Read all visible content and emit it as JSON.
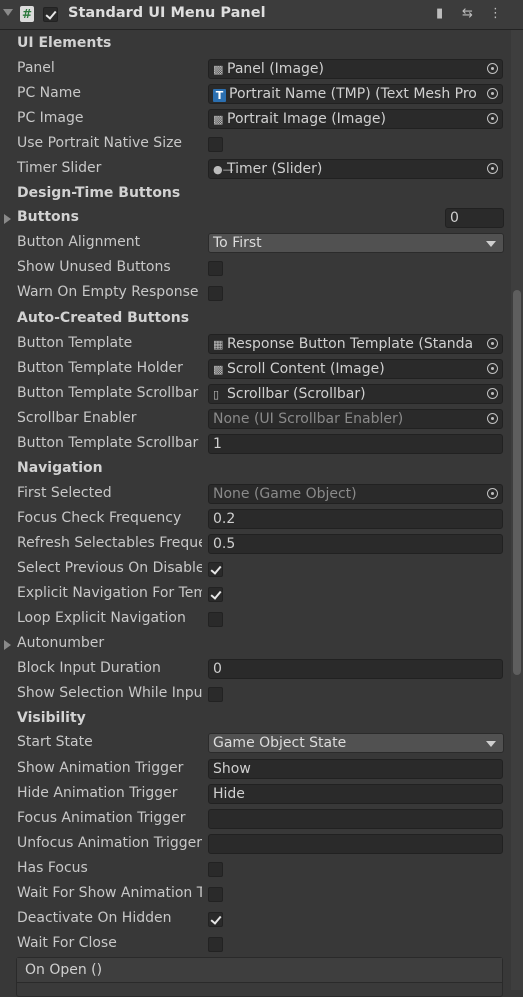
{
  "header": {
    "title": "Standard UI Menu Panel",
    "enabled": true,
    "icon_names": [
      "fold-arrow-icon",
      "script-icon",
      "preset-icon",
      "settings-sliders-icon",
      "kebab-menu-icon"
    ]
  },
  "sections": {
    "ui_elements": "UI Elements",
    "design_time_buttons": "Design-Time Buttons",
    "auto_created_buttons": "Auto-Created Buttons",
    "navigation": "Navigation",
    "visibility": "Visibility"
  },
  "fields": {
    "panel": {
      "label": "Panel",
      "value": "Panel (Image)"
    },
    "pc_name": {
      "label": "PC Name",
      "value": "Portrait Name (TMP) (Text Mesh Pro"
    },
    "pc_image": {
      "label": "PC Image",
      "value": "Portrait Image (Image)"
    },
    "use_portrait_native_size": {
      "label": "Use Portrait Native Size",
      "checked": false
    },
    "timer_slider": {
      "label": "Timer Slider",
      "value": "Timer (Slider)"
    },
    "buttons": {
      "label": "Buttons",
      "value": "0"
    },
    "button_alignment": {
      "label": "Button Alignment",
      "value": "To First"
    },
    "show_unused_buttons": {
      "label": "Show Unused Buttons",
      "checked": false
    },
    "warn_on_empty_response": {
      "label": "Warn On Empty Response",
      "checked": false
    },
    "button_template": {
      "label": "Button Template",
      "value": "Response Button Template (Standa"
    },
    "button_template_holder": {
      "label": "Button Template Holder",
      "value": "Scroll Content (Image)"
    },
    "button_template_scrollbar": {
      "label": "Button Template Scrollbar",
      "value": "Scrollbar (Scrollbar)"
    },
    "scrollbar_enabler": {
      "label": "Scrollbar Enabler",
      "value": "None (UI Scrollbar Enabler)"
    },
    "button_template_scrollbar_value": {
      "label": "Button Template Scrollbar",
      "value": "1"
    },
    "first_selected": {
      "label": "First Selected",
      "value": "None (Game Object)"
    },
    "focus_check_frequency": {
      "label": "Focus Check Frequency",
      "value": "0.2"
    },
    "refresh_selectables_frequency": {
      "label": "Refresh Selectables Freque",
      "value": "0.5"
    },
    "select_previous_on_disable": {
      "label": "Select Previous On Disable",
      "checked": true
    },
    "explicit_navigation": {
      "label": "Explicit Navigation For Tem",
      "checked": true
    },
    "loop_explicit_navigation": {
      "label": "Loop Explicit Navigation",
      "checked": false
    },
    "autonumber": {
      "label": "Autonumber"
    },
    "block_input_duration": {
      "label": "Block Input Duration",
      "value": "0"
    },
    "show_selection_while_input": {
      "label": "Show Selection While Inpu",
      "checked": false
    },
    "start_state": {
      "label": "Start State",
      "value": "Game Object State"
    },
    "show_animation_trigger": {
      "label": "Show Animation Trigger",
      "value": "Show"
    },
    "hide_animation_trigger": {
      "label": "Hide Animation Trigger",
      "value": "Hide"
    },
    "focus_animation_trigger": {
      "label": "Focus Animation Trigger",
      "value": ""
    },
    "unfocus_animation_trigger": {
      "label": "Unfocus Animation Trigger",
      "value": ""
    },
    "has_focus": {
      "label": "Has Focus",
      "checked": false
    },
    "wait_for_show_animation": {
      "label": "Wait For Show Animation T",
      "checked": false
    },
    "deactivate_on_hidden": {
      "label": "Deactivate On Hidden",
      "checked": true
    },
    "wait_for_close": {
      "label": "Wait For Close",
      "checked": false
    }
  },
  "events": {
    "on_open": "On Open ()"
  },
  "colors": {
    "background": "#383838",
    "field": "#2a2a2a",
    "dropdown": "#515151",
    "text": "#c8c8c8"
  }
}
